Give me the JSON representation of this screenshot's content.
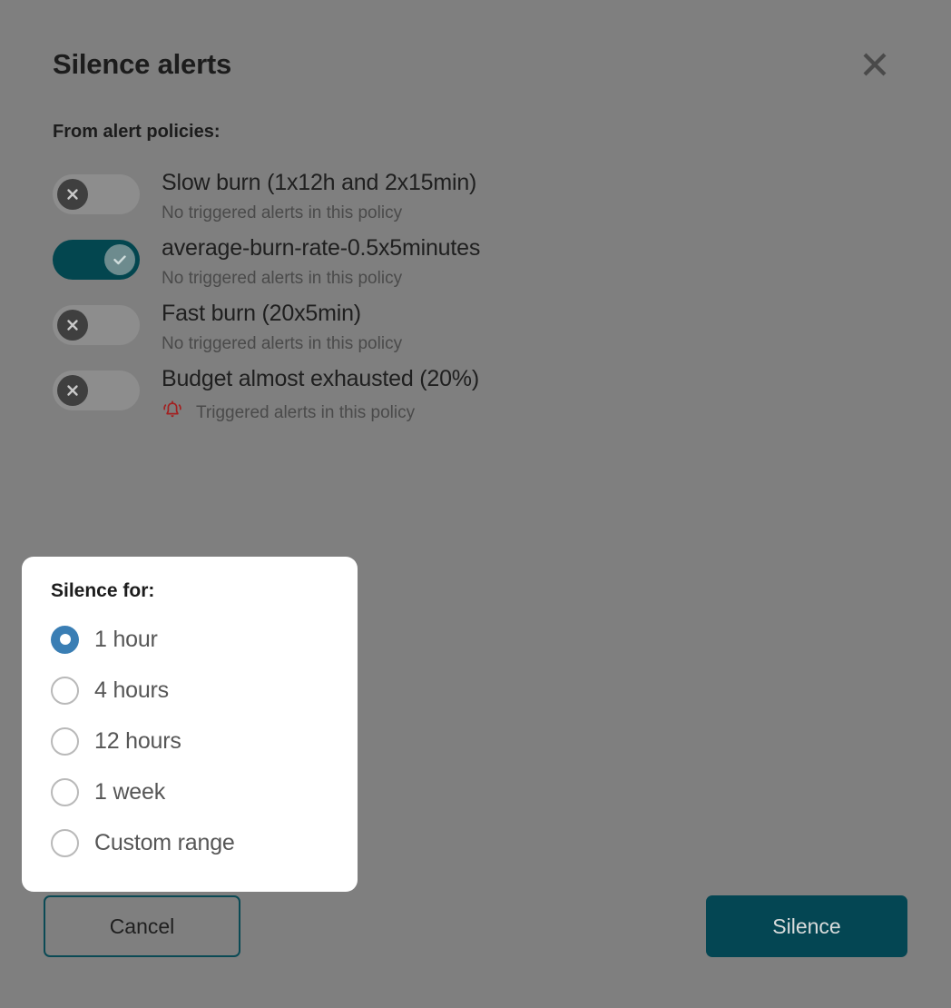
{
  "dialog": {
    "title": "Silence alerts",
    "close_icon": "close-icon",
    "section_label": "From alert policies:"
  },
  "policies": [
    {
      "name": "Slow burn (1x12h and 2x15min)",
      "status": "No triggered alerts in this policy",
      "enabled": false,
      "triggered": false,
      "toggle_icon": "x-icon"
    },
    {
      "name": "average-burn-rate-0.5x5minutes",
      "status": "No triggered alerts in this policy",
      "enabled": true,
      "triggered": false,
      "toggle_icon": "check-icon"
    },
    {
      "name": "Fast burn (20x5min)",
      "status": "No triggered alerts in this policy",
      "enabled": false,
      "triggered": false,
      "toggle_icon": "x-icon"
    },
    {
      "name": "Budget almost exhausted (20%)",
      "status": "Triggered alerts in this policy",
      "enabled": false,
      "triggered": true,
      "toggle_icon": "x-icon",
      "status_icon": "bell-ringing-icon"
    }
  ],
  "silence_popup": {
    "title": "Silence for:",
    "selected": "1 hour",
    "options": [
      {
        "label": "1 hour",
        "selected": true
      },
      {
        "label": "4 hours",
        "selected": false
      },
      {
        "label": "12 hours",
        "selected": false
      },
      {
        "label": "1 week",
        "selected": false
      },
      {
        "label": "Custom range",
        "selected": false
      }
    ]
  },
  "footer": {
    "cancel_label": "Cancel",
    "silence_label": "Silence"
  },
  "colors": {
    "overlay": "#7f7f7f",
    "accent_teal": "#044653",
    "toggle_on": "#03464f",
    "toggle_off": "#8d8d8d",
    "radio_selected": "#3a7eb4",
    "alert_red": "#a32020",
    "popup_bg": "#ffffff"
  }
}
